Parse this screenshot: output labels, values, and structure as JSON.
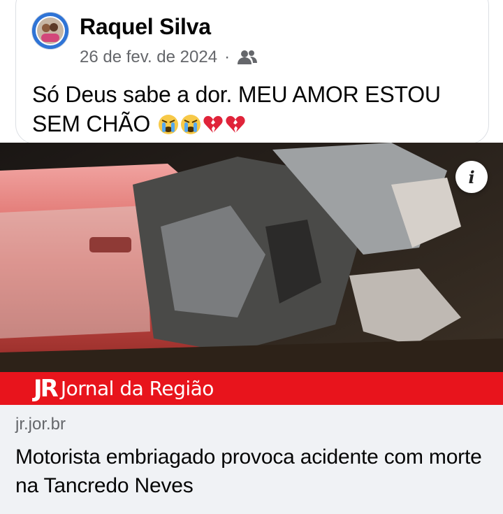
{
  "post": {
    "author": "Raquel Silva",
    "date": "26 de fev. de 2024",
    "separator": "·",
    "audience_icon": "friends-icon",
    "text": "Só Deus sabe a dor. MEU AMOR ESTOU SEM CHÃO",
    "emojis": [
      "crying-face",
      "crying-face",
      "broken-heart",
      "broken-heart"
    ]
  },
  "image": {
    "info_label": "i",
    "banner": {
      "logo": "JR",
      "name": "Jornal da Região"
    }
  },
  "link_preview": {
    "domain": "jr.jor.br",
    "title": "Motorista embriagado provoca acidente com morte na Tancredo Neves"
  },
  "colors": {
    "brand_red": "#e8141c",
    "secondary_text": "#65676b",
    "link_bg": "#f0f2f5"
  }
}
